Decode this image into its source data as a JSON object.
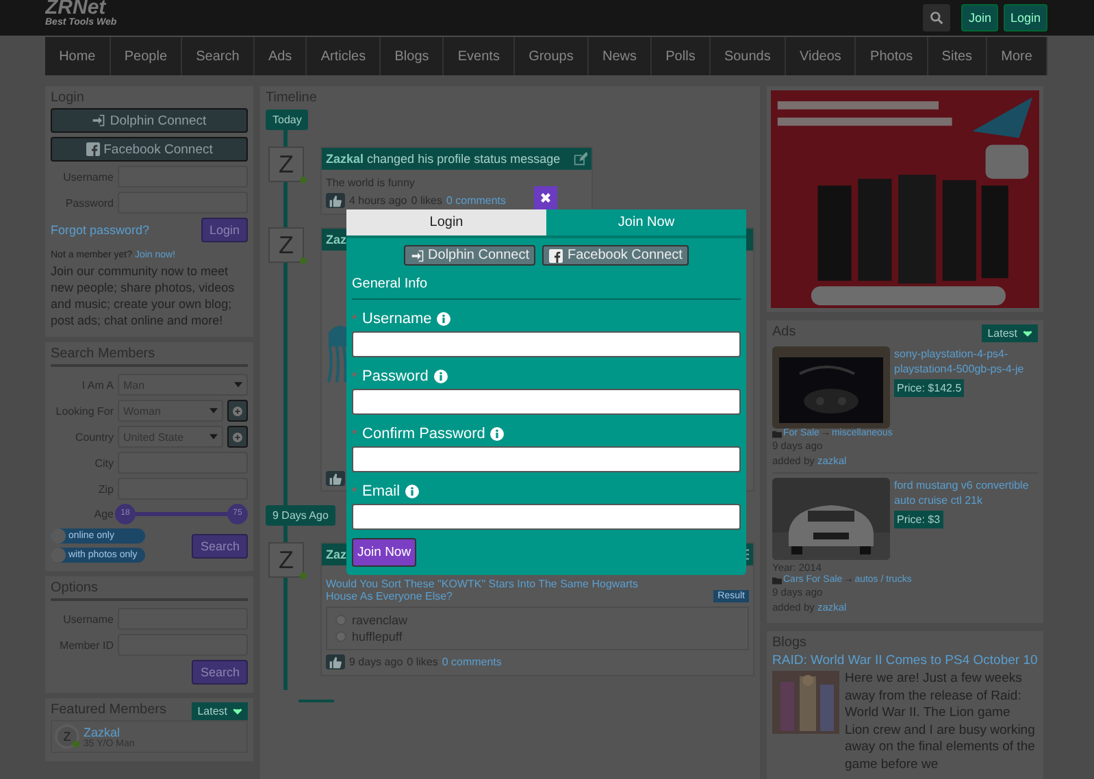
{
  "header": {
    "logo": "ZRNet",
    "tagline": "Best Tools Web",
    "buttons": [
      "Join",
      "Login"
    ]
  },
  "nav": {
    "items": [
      "Home",
      "People",
      "Search",
      "Ads",
      "Articles",
      "Blogs",
      "Events",
      "Groups",
      "News",
      "Polls",
      "Sounds",
      "Videos",
      "Photos",
      "Sites",
      "More"
    ]
  },
  "login_panel": {
    "title": "Login",
    "connect_buttons": [
      {
        "kind": "dolphin",
        "label": "Dolphin Connect"
      },
      {
        "kind": "facebook",
        "label": "Facebook Connect"
      }
    ],
    "fields": [
      {
        "label": "Username"
      },
      {
        "label": "Password"
      }
    ],
    "forgot_link": "Forgot password?",
    "login_button": "Login",
    "not_member": "Not a member yet?",
    "join_link": "Join now!",
    "blurb": "Join our community now to meet new people; share photos, videos and music; create your own blog; post ads; chat online and more!"
  },
  "search_members": {
    "title": "Search Members",
    "fields": [
      {
        "label": "I Am A",
        "kind": "select",
        "value": "Man"
      },
      {
        "label": "Looking For",
        "kind": "select_add",
        "value": "Woman"
      },
      {
        "label": "Country",
        "kind": "select_add",
        "value": "United State"
      },
      {
        "label": "City",
        "kind": "text"
      },
      {
        "label": "Zip",
        "kind": "text"
      }
    ],
    "age": {
      "label": "Age",
      "min": "18",
      "max": "75"
    },
    "toggles": [
      {
        "label": "online only",
        "on": false
      },
      {
        "label": "with photos only",
        "on": false
      }
    ],
    "button": "Search"
  },
  "options": {
    "title": "Options",
    "fields": [
      {
        "label": "Username"
      },
      {
        "label": "Member ID"
      }
    ],
    "button": "Search"
  },
  "featured": {
    "title": "Featured Members",
    "dropdown": "Latest",
    "members": [
      {
        "initial": "Z",
        "name": "Zazkal",
        "info": "35 Y/O Man"
      }
    ]
  },
  "timeline": {
    "title": "Timeline",
    "groups": [
      {
        "label": "Today",
        "posts": [
          {
            "kind": "status",
            "avatar": "Z",
            "author": "Zazkal",
            "action": "changed his profile status message",
            "body": "The world is funny",
            "time": "4 hours ago",
            "likes": "0 likes",
            "comments": "0 comments"
          },
          {
            "avatar": "Z",
            "author": "Zaz"
          }
        ]
      },
      {
        "label": "9 Days Ago",
        "posts": [
          {
            "kind": "poll",
            "avatar": "Z",
            "author": "Zaz",
            "question": "Would You Sort These \"KOWTK\" Stars Into The Same Hogwarts House As Everyone Else?",
            "result": "Result",
            "choices": [
              {
                "label": "ravenclaw",
                "selected": false
              },
              {
                "label": "hufflepuff",
                "selected": false
              }
            ],
            "time": "9 days ago",
            "likes": "0 likes",
            "comments": "0 comments"
          }
        ]
      }
    ]
  },
  "ads": {
    "title": "Ads",
    "dropdown": "Latest",
    "items": [
      {
        "title": "sony-playstation-4-ps4-playstation4-500gb-ps-4-je",
        "price": "Price: $142.5",
        "category": "For Sale",
        "separator": "→",
        "subcategory": "miscellaneous",
        "time": "9 days ago",
        "added_by": "added by",
        "user": "zazkal"
      },
      {
        "title": "ford mustang v6 convertible auto cruise ctl 21k",
        "price": "Price: $3",
        "year": "Year: 2014",
        "category": "Cars For Sale",
        "separator": "→",
        "subcategory": "autos / trucks",
        "time": "9 days ago",
        "added_by": "added by",
        "user": "zazkal"
      }
    ]
  },
  "blogs": {
    "title": "Blogs",
    "post_title": "RAID: World War II Comes to PS4 October 10",
    "excerpt": "Here we are! Just a few weeks away from the release of Raid: World War II. The Lion game Lion crew and I are busy working away on the final elements of the game before we"
  },
  "modal": {
    "tabs": [
      {
        "label": "Login",
        "selected": false
      },
      {
        "label": "Join Now",
        "selected": true
      }
    ],
    "connect_buttons": [
      {
        "kind": "dolphin",
        "label": "Dolphin Connect"
      },
      {
        "kind": "facebook",
        "label": "Facebook Connect"
      }
    ],
    "section": "General Info",
    "required_mark": "*",
    "fields": [
      {
        "label": "Username",
        "required": true
      },
      {
        "label": "Password",
        "required": true
      },
      {
        "label": "Confirm Password",
        "required": true
      },
      {
        "label": "Email",
        "required": true
      }
    ],
    "submit": "Join Now"
  }
}
